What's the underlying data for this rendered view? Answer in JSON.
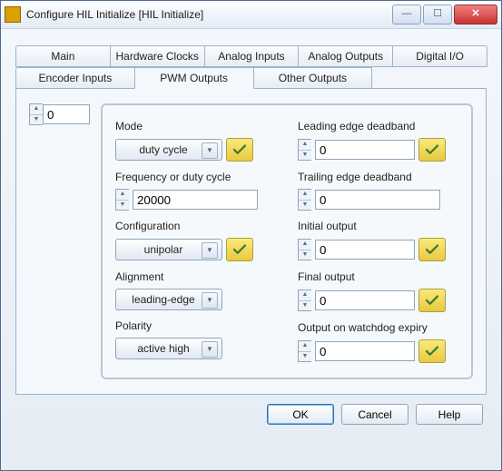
{
  "window": {
    "title": "Configure HIL Initialize [HIL Initialize]"
  },
  "tabs": {
    "row1": [
      "Main",
      "Hardware Clocks",
      "Analog Inputs",
      "Analog Outputs",
      "Digital I/O"
    ],
    "row2": [
      "Encoder Inputs",
      "PWM Outputs",
      "Other Outputs"
    ],
    "active": "PWM Outputs"
  },
  "channel": {
    "value": "0"
  },
  "left": {
    "mode": {
      "label": "Mode",
      "value": "duty cycle"
    },
    "freq": {
      "label": "Frequency or duty cycle",
      "value": "20000"
    },
    "config": {
      "label": "Configuration",
      "value": "unipolar"
    },
    "align": {
      "label": "Alignment",
      "value": "leading-edge"
    },
    "polarity": {
      "label": "Polarity",
      "value": "active high"
    }
  },
  "right": {
    "lead": {
      "label": "Leading edge deadband",
      "value": "0"
    },
    "trail": {
      "label": "Trailing edge deadband",
      "value": "0"
    },
    "init": {
      "label": "Initial output",
      "value": "0"
    },
    "final": {
      "label": "Final output",
      "value": "0"
    },
    "wdog": {
      "label": "Output on watchdog expiry",
      "value": "0"
    }
  },
  "buttons": {
    "ok": "OK",
    "cancel": "Cancel",
    "help": "Help"
  },
  "glyph": {
    "min": "—",
    "max": "☐",
    "close": "✕",
    "up": "▲",
    "down": "▼"
  }
}
